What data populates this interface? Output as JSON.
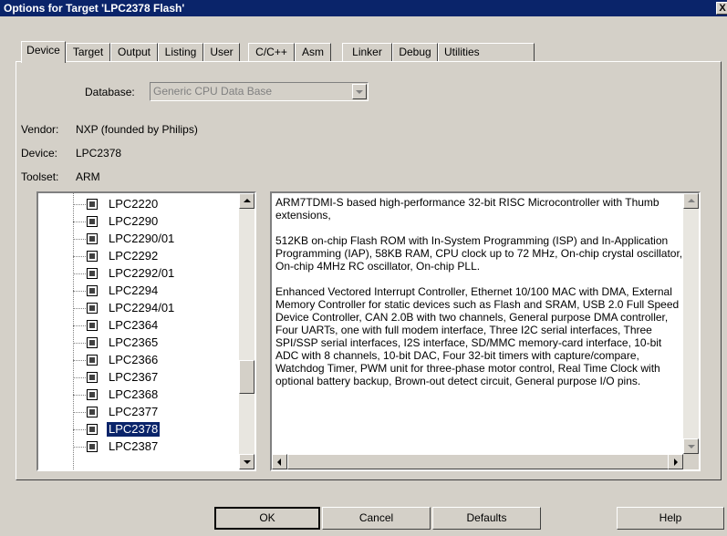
{
  "window": {
    "title": "Options for Target 'LPC2378 Flash'",
    "close_label": "X"
  },
  "tabs": [
    {
      "label": "Device",
      "active": true
    },
    {
      "label": "Target"
    },
    {
      "label": "Output"
    },
    {
      "label": "Listing"
    },
    {
      "label": "User"
    },
    {
      "label": "C/C++"
    },
    {
      "label": "Asm"
    },
    {
      "label": "Linker"
    },
    {
      "label": "Debug"
    },
    {
      "label": "Utilities"
    }
  ],
  "database": {
    "label": "Database:",
    "value": "Generic CPU Data Base"
  },
  "info": {
    "vendor_label": "Vendor:",
    "vendor": "NXP (founded by Philips)",
    "device_label": "Device:",
    "device": "LPC2378",
    "toolset_label": "Toolset:",
    "toolset": "ARM"
  },
  "device_list": {
    "items": [
      "LPC2220",
      "LPC2290",
      "LPC2290/01",
      "LPC2292",
      "LPC2292/01",
      "LPC2294",
      "LPC2294/01",
      "LPC2364",
      "LPC2365",
      "LPC2366",
      "LPC2367",
      "LPC2368",
      "LPC2377",
      "LPC2378",
      "LPC2387"
    ],
    "selected": "LPC2378"
  },
  "description": {
    "paragraphs": [
      "ARM7TDMI-S based high-performance 32-bit RISC Microcontroller with Thumb extensions,",
      "512KB on-chip Flash ROM with In-System Programming (ISP) and In-Application Programming (IAP), 58KB RAM, CPU clock up to 72 MHz, On-chip crystal oscillator, On-chip 4MHz RC oscillator, On-chip PLL.",
      "Enhanced Vectored Interrupt Controller, Ethernet 10/100 MAC with DMA, External Memory Controller for static devices such as Flash and SRAM, USB 2.0  Full Speed Device Controller, CAN 2.0B with two channels, General purpose DMA controller, Four UARTs, one with full modem interface, Three I2C serial interfaces, Three SPI/SSP serial interfaces, I2S interface, SD/MMC memory-card interface, 10-bit ADC with 8 channels, 10-bit DAC, Four 32-bit timers with capture/compare, Watchdog Timer, PWM unit for three-phase motor control, Real Time Clock with optional battery backup, Brown-out detect circuit, General purpose I/O pins."
    ]
  },
  "buttons": {
    "ok": "OK",
    "cancel": "Cancel",
    "defaults": "Defaults",
    "help": "Help"
  }
}
